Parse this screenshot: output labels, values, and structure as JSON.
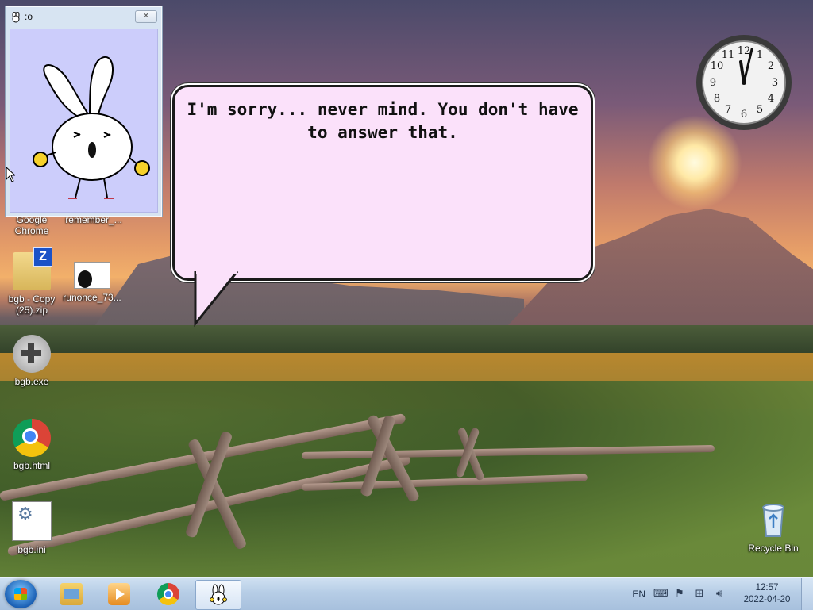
{
  "desktop": {
    "icons": [
      {
        "id": "google-chrome",
        "label": "Google\nChrome"
      },
      {
        "id": "remember",
        "label": "remember_..."
      },
      {
        "id": "bgb-zip",
        "label": "bgb - Copy\n(25).zip"
      },
      {
        "id": "runonce",
        "label": "runonce_73..."
      },
      {
        "id": "bgb-exe",
        "label": "bgb.exe"
      },
      {
        "id": "bgb-html",
        "label": "bgb.html"
      },
      {
        "id": "bgb-ini",
        "label": "bgb.ini"
      },
      {
        "id": "recycle-bin",
        "label": "Recycle Bin"
      }
    ]
  },
  "bunny_window": {
    "title": ":o"
  },
  "speech_bubble": {
    "text": "I'm sorry... never mind. You don't have to answer that."
  },
  "clock_gadget": {
    "numerals": [
      "12",
      "1",
      "2",
      "3",
      "4",
      "5",
      "6",
      "7",
      "8",
      "9",
      "10",
      "11"
    ],
    "time": "12:57"
  },
  "taskbar": {
    "pinned": [
      "Windows Explorer",
      "Windows Media Player",
      "Google Chrome",
      "bunny app"
    ],
    "active_item": "bunny app",
    "tray": {
      "language": "EN",
      "time": "12:57",
      "date": "2022-04-20"
    }
  },
  "colors": {
    "bubble_fill": "#fbe1fa",
    "bunny_window_bg": "#cccdfb",
    "taskbar": "#b6cde6"
  }
}
